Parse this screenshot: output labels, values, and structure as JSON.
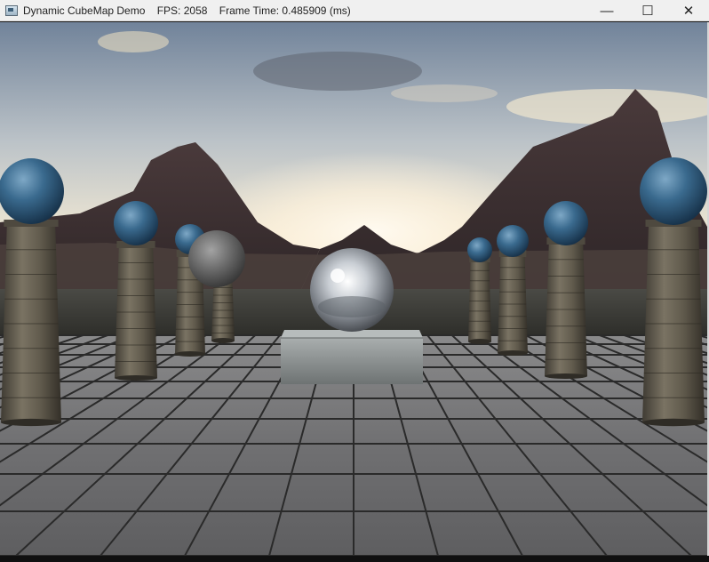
{
  "window": {
    "title": "Dynamic CubeMap Demo    FPS: 2058    Frame Time: 0.485909 (ms)",
    "minimize_glyph": "—",
    "maximize_glyph": "☐",
    "close_glyph": "✕"
  },
  "scene": {
    "icons": {
      "app": "app-window-icon",
      "minimize": "minimize-icon",
      "maximize": "maximize-icon",
      "close": "close-icon"
    },
    "colors": {
      "sky_top": "#7d8c9e",
      "sky_horizon": "#f2ecd9",
      "sun_glow": "#fff7e6",
      "mountain": "#3d2f31",
      "floor_tile": "#6f6f71",
      "grout": "#2b2b2b",
      "pillar_stone": "#5b5548",
      "blue_sphere": "#2e5a7c",
      "chrome_sphere": "#d9dde2",
      "gray_sphere": "#6d6d6d",
      "pedestal": "#8a8f8f"
    }
  }
}
